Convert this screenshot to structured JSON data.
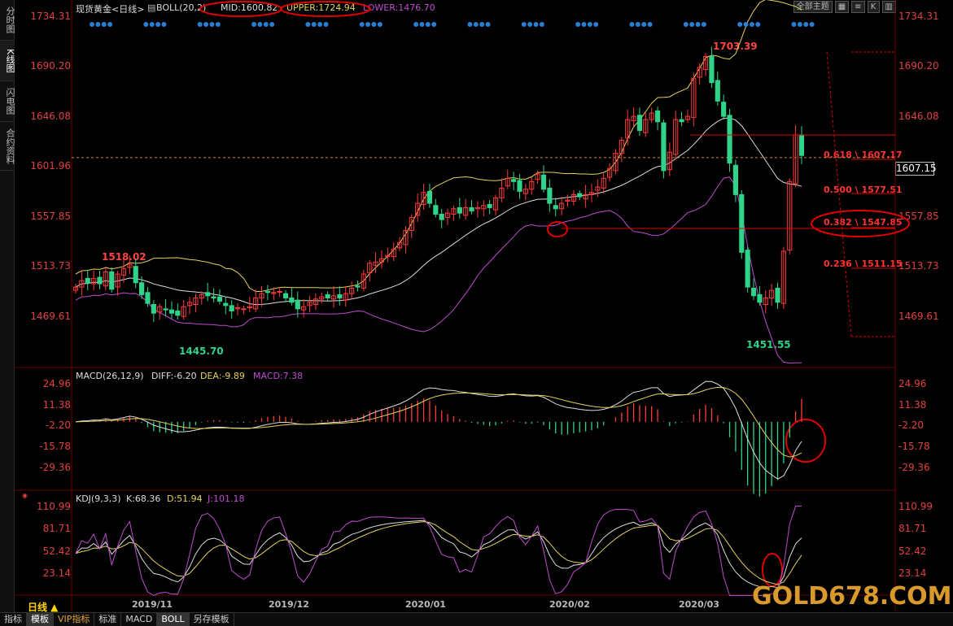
{
  "left_tabs": [
    "分时图",
    "K线图",
    "闪电图",
    "合约资料"
  ],
  "legend": {
    "title": "现货黄金<日线>",
    "boll_name": "BOLL(20,2)",
    "mid": "MID:1600.82",
    "upper": "UPPER:1724.94",
    "lower": "LOWER:1476.70"
  },
  "toolbar": {
    "main_index": "全部主题",
    "btn_icons": [
      "grid-icon",
      "list-icon",
      "k-icon",
      "bars-icon"
    ]
  },
  "price_axis": [
    "1734.31",
    "1690.20",
    "1646.08",
    "1601.96",
    "1557.85",
    "1513.73",
    "1469.61"
  ],
  "current_price": "1607.15",
  "fib_labels": [
    "0.618 \\ 1607.17",
    "0.500 \\ 1577.51",
    "0.382 \\ 1547.85",
    "0.236 \\ 1511.15"
  ],
  "peaks": {
    "high_left": "1518.02",
    "low_left": "1445.70",
    "high_right": "1703.39",
    "low_right": "1451.55"
  },
  "macd": {
    "title": "MACD(26,12,9)",
    "dif": "DIFF:-6.20",
    "dea": "DEA:-9.89",
    "macd": "MACD:7.38",
    "axis": [
      "24.96",
      "11.38",
      "-2.20",
      "-15.78",
      "-29.36"
    ]
  },
  "kdj": {
    "title": "KDJ(9,3,3)",
    "k": "K:68.36",
    "d": "D:51.94",
    "j": "J:101.18",
    "axis": [
      "110.99",
      "81.71",
      "52.42",
      "23.14"
    ]
  },
  "dates": [
    "2019/11",
    "2019/12",
    "2020/01",
    "2020/02",
    "2020/03"
  ],
  "period_button": "日线 ▲",
  "bottom_tabs": [
    "指标",
    "模板",
    "VIP指标",
    "标准",
    "MACD",
    "BOLL",
    "另存模板"
  ],
  "watermark": "GOLD678.COM",
  "colors": {
    "up": "#ff3b3b",
    "down": "#2fd38a",
    "upper": "#e6d25a",
    "mid": "#dddddd",
    "lower": "#c04bd0",
    "annot": "#e00000"
  },
  "chart_data": {
    "type": "candlestick",
    "title": "现货黄金<日线>",
    "ylim": [
      1435,
      1740
    ],
    "close": [
      1488,
      1494,
      1492,
      1496,
      1491,
      1502,
      1486,
      1500,
      1505,
      1509,
      1492,
      1481,
      1473,
      1464,
      1470,
      1467,
      1464,
      1462,
      1470,
      1474,
      1478,
      1481,
      1480,
      1478,
      1475,
      1471,
      1466,
      1469,
      1468,
      1470,
      1478,
      1482,
      1483,
      1483,
      1484,
      1478,
      1474,
      1468,
      1470,
      1474,
      1477,
      1479,
      1478,
      1480,
      1478,
      1482,
      1487,
      1488,
      1500,
      1510,
      1511,
      1514,
      1517,
      1523,
      1529,
      1540,
      1552,
      1565,
      1575,
      1565,
      1555,
      1550,
      1556,
      1560,
      1556,
      1561,
      1558,
      1561,
      1563,
      1561,
      1570,
      1579,
      1588,
      1585,
      1576,
      1578,
      1585,
      1592,
      1578,
      1565,
      1560,
      1565,
      1568,
      1573,
      1571,
      1573,
      1575,
      1580,
      1588,
      1597,
      1611,
      1623,
      1642,
      1645,
      1632,
      1642,
      1648,
      1640,
      1595,
      1612,
      1642,
      1640,
      1645,
      1680,
      1690,
      1700,
      1676,
      1659,
      1645,
      1602,
      1573,
      1520,
      1488,
      1480,
      1474,
      1478,
      1485,
      1474,
      1521,
      1585,
      1628,
      1609
    ],
    "volume_hint": "none"
  }
}
